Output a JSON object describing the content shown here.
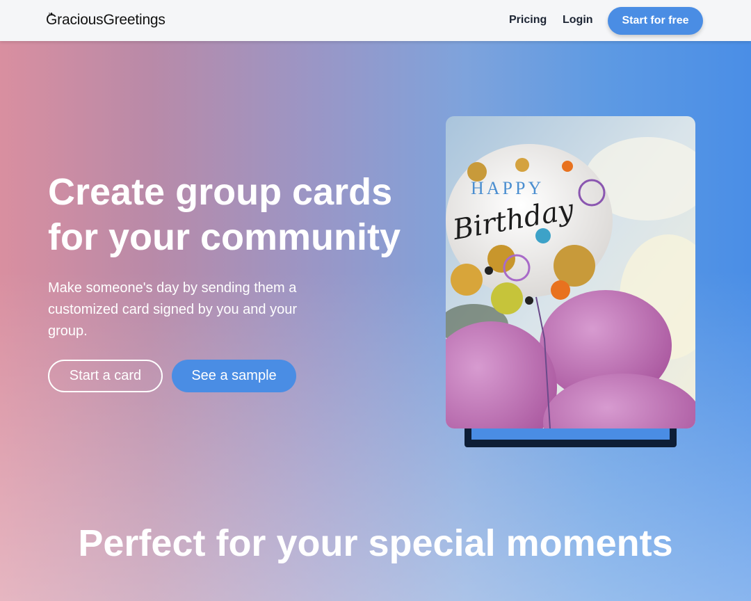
{
  "brand": {
    "name": "GraciousGreetings"
  },
  "nav": {
    "pricing": "Pricing",
    "login": "Login",
    "cta": "Start for free"
  },
  "hero": {
    "title": "Create group cards for your community",
    "subtitle": "Make someone's day by sending them a customized card signed by you and your group.",
    "primary_button": "Start a card",
    "secondary_button": "See a sample"
  },
  "image": {
    "balloon_text_top": "HAPPY",
    "balloon_text_main": "Birthday"
  },
  "section": {
    "title": "Perfect for your special moments"
  },
  "colors": {
    "accent": "#4a8de4",
    "nav_bg": "#f5f6f8",
    "frame": "#0e1e36"
  }
}
